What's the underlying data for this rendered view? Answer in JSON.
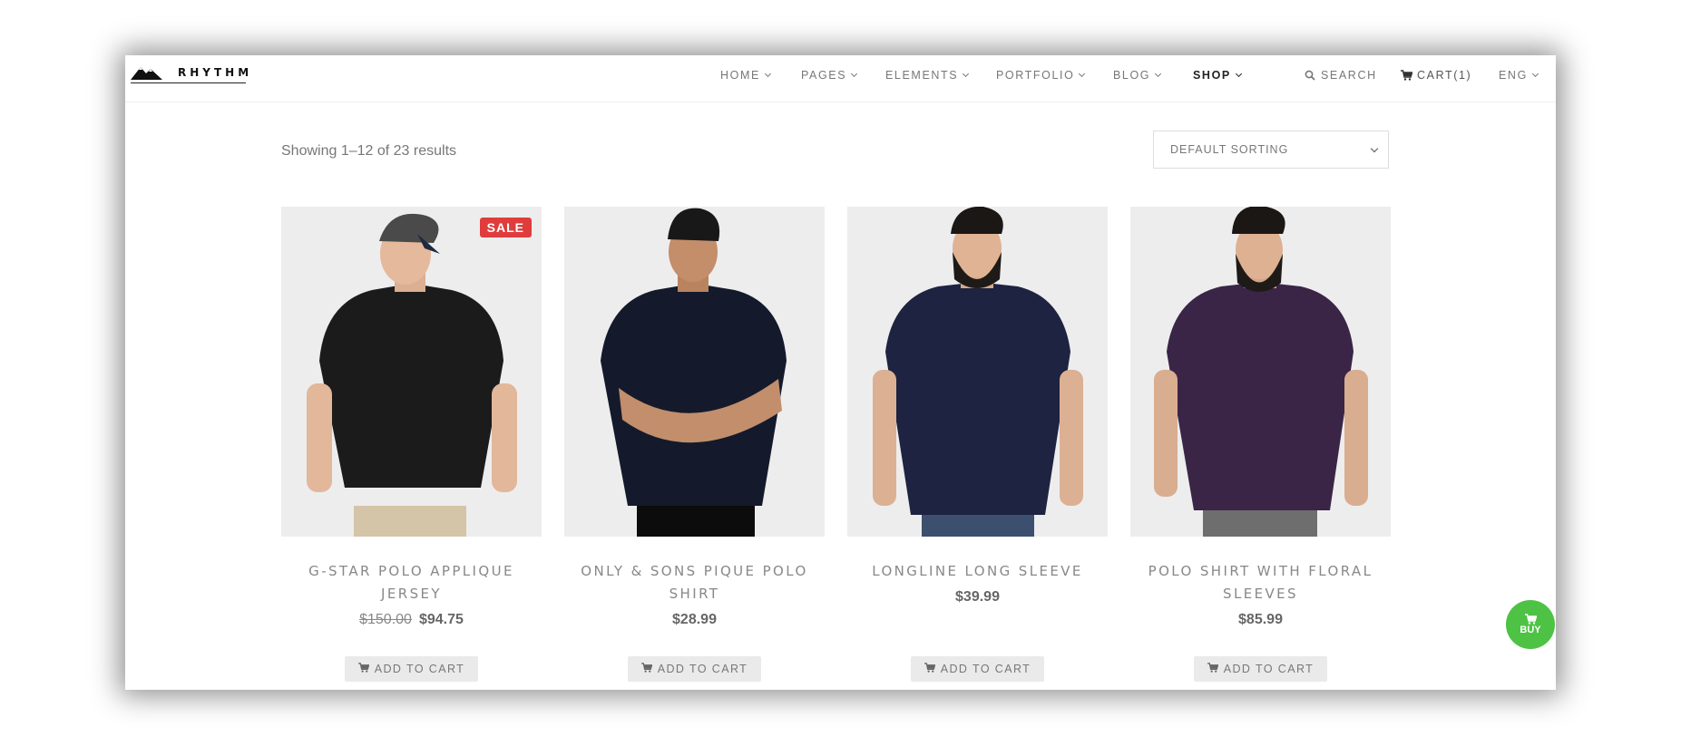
{
  "brand": {
    "logo_text": "RHYTHM"
  },
  "nav": {
    "items": [
      {
        "label": "HOME"
      },
      {
        "label": "PAGES"
      },
      {
        "label": "ELEMENTS"
      },
      {
        "label": "PORTFOLIO"
      },
      {
        "label": "BLOG"
      },
      {
        "label": "SHOP"
      }
    ],
    "active": "SHOP",
    "search_label": "SEARCH",
    "cart_label": "CART(1)",
    "lang_label": "ENG"
  },
  "toolbar": {
    "result_count": "Showing 1–12 of 23 results",
    "sort_value": "DEFAULT SORTING"
  },
  "products": [
    {
      "name": "G-STAR POLO APPLIQUE JERSEY",
      "old_price": "$150.00",
      "price": "$94.75",
      "badge": "SALE",
      "button": "ADD TO CART",
      "shirt_color": "#1b1b1b"
    },
    {
      "name": "ONLY & SONS PIQUE POLO SHIRT",
      "price": "$28.99",
      "button": "ADD TO CART",
      "shirt_color": "#141a2b"
    },
    {
      "name": "LONGLINE LONG SLEEVE",
      "price": "$39.99",
      "button": "ADD TO CART",
      "shirt_color": "#1d2340"
    },
    {
      "name": "POLO SHIRT WITH FLORAL SLEEVES",
      "price": "$85.99",
      "button": "ADD TO CART",
      "shirt_color": "#3a2547"
    }
  ],
  "buy_button": {
    "label": "BUY"
  },
  "colors": {
    "sale_badge": "#e03c3c",
    "buy_green": "#4ec244"
  }
}
